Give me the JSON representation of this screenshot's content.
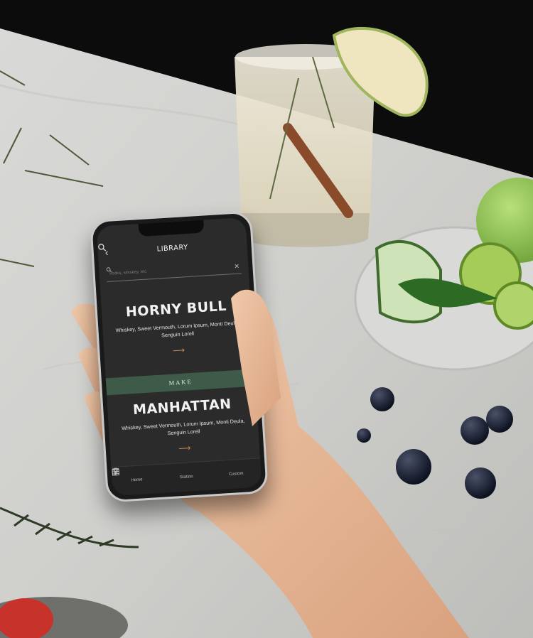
{
  "phone_app": {
    "header": {
      "title": "LIBRARY"
    },
    "search": {
      "placeholder": "Vodka, whiskey, etc."
    },
    "cards": [
      {
        "name": "HORNY BULL",
        "ingredients": "Whiskey, Sweet Vermouth, Lorum Ipsum, Monti Deula, Senguin Lorell"
      },
      {
        "name": "MANHATTAN",
        "ingredients": "Whiskey, Sweet Vermouth, Lorum Ipsum, Monti Deula, Senguin Lorell"
      }
    ],
    "make_label": "MAKE",
    "tabs": [
      {
        "label": "Home",
        "icon": "cocktail-glass-icon"
      },
      {
        "label": "Station",
        "icon": "station-icon"
      },
      {
        "label": "Custom",
        "icon": "sliders-icon"
      }
    ]
  },
  "colors": {
    "make_bar": "#3e5b49",
    "arrow": "#c58a58",
    "screen_bg": "#2b2b2b"
  }
}
